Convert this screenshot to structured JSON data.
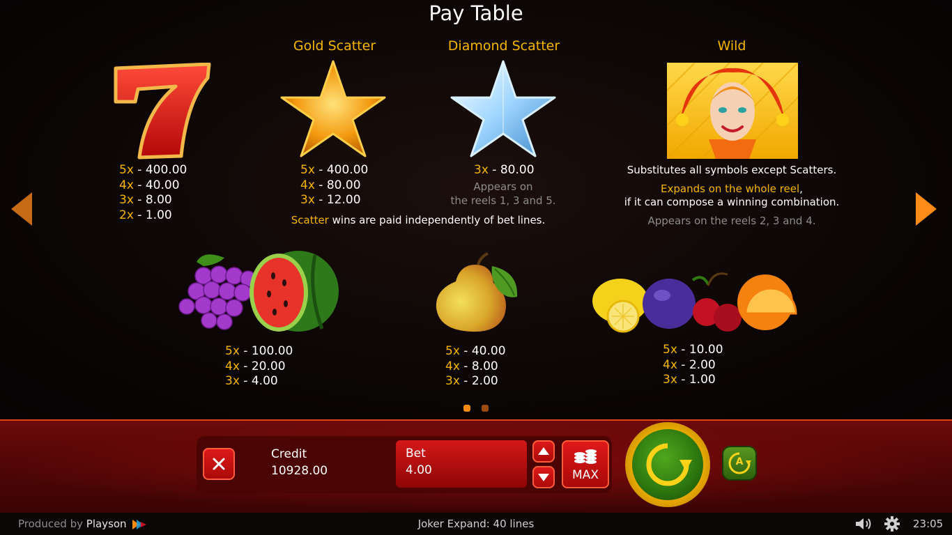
{
  "title": "Pay Table",
  "symbols": {
    "seven": {
      "pays": [
        {
          "m": "5x",
          "v": "400.00"
        },
        {
          "m": "4x",
          "v": "40.00"
        },
        {
          "m": "3x",
          "v": "8.00"
        },
        {
          "m": "2x",
          "v": "1.00"
        }
      ]
    },
    "gold_scatter": {
      "title": "Gold Scatter",
      "pays": [
        {
          "m": "5x",
          "v": "400.00"
        },
        {
          "m": "4x",
          "v": "80.00"
        },
        {
          "m": "3x",
          "v": "12.00"
        }
      ]
    },
    "diamond_scatter": {
      "title": "Diamond Scatter",
      "pays": [
        {
          "m": "3x",
          "v": "80.00"
        }
      ],
      "note1": "Appears on",
      "note2": "the reels 1, 3 and 5."
    },
    "scatter_note": {
      "word": "Scatter",
      "rest": " wins are paid independently of bet lines."
    },
    "wild": {
      "title": "Wild",
      "line1": "Substitutes all symbols except Scatters.",
      "line2_gold": "Expands on the whole reel",
      "line2_rest": ",",
      "line3": "if it can compose a winning combination.",
      "line4": "Appears on the reels 2, 3 and 4."
    },
    "grapes_melon": {
      "pays": [
        {
          "m": "5x",
          "v": "100.00"
        },
        {
          "m": "4x",
          "v": "20.00"
        },
        {
          "m": "3x",
          "v": "4.00"
        }
      ]
    },
    "pear": {
      "pays": [
        {
          "m": "5x",
          "v": "40.00"
        },
        {
          "m": "4x",
          "v": "8.00"
        },
        {
          "m": "3x",
          "v": "2.00"
        }
      ]
    },
    "fruits": {
      "pays": [
        {
          "m": "5x",
          "v": "10.00"
        },
        {
          "m": "4x",
          "v": "2.00"
        },
        {
          "m": "3x",
          "v": "1.00"
        }
      ]
    }
  },
  "separator": " - ",
  "controls": {
    "credit_label": "Credit",
    "credit_value": "10928.00",
    "bet_label": "Bet",
    "bet_value": "4.00",
    "max_label": "MAX",
    "autoplay_letter": "A"
  },
  "footer": {
    "produced_by": "Produced by",
    "brand": "Playson",
    "game_info": "Joker Expand: 40 lines",
    "clock": "23:05"
  },
  "colors": {
    "accent": "#f7b500",
    "bar": "#5a0707",
    "spin": "#2f7a10"
  }
}
